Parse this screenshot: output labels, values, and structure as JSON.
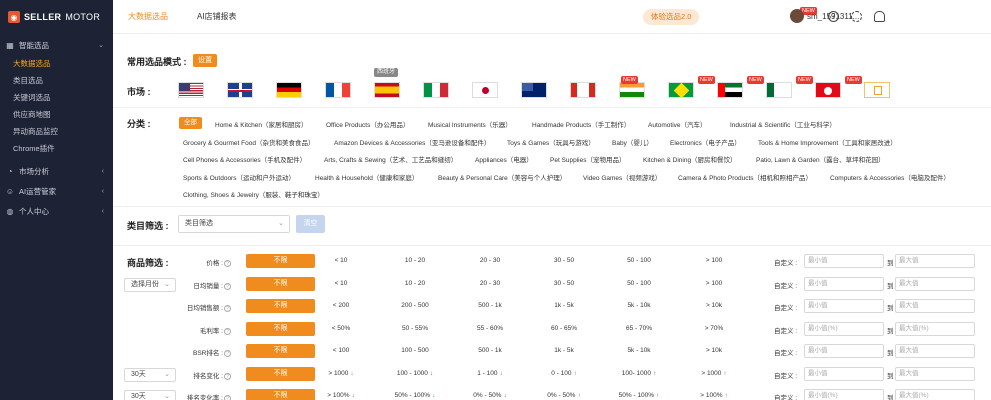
{
  "sidebar": {
    "logo": {
      "bold": "SELLER",
      "thin": "MOTOR"
    },
    "groups": [
      {
        "label": "智能选品",
        "icon": "grid-icon"
      },
      {
        "label": "市场分析",
        "icon": "chart-icon"
      },
      {
        "label": "AI运营管家",
        "icon": "robot-icon"
      },
      {
        "label": "个人中心",
        "icon": "user-icon"
      }
    ],
    "sub_items": [
      "大数据选品",
      "类目选品",
      "关键词选品",
      "供应商地图",
      "异动商品监控",
      "Chrome插件"
    ]
  },
  "header": {
    "tabs": [
      "大数据选品",
      "AI店铺报表"
    ],
    "trial_label": "体验选品2.0",
    "new_label": "NEW",
    "help_glyph": "?",
    "user_name": "sm_1591311..."
  },
  "common_mode": {
    "label": "常用选品模式 :",
    "button": "设置"
  },
  "market": {
    "label": "市场 :",
    "tooltip": "西班牙",
    "new_label": "NEW"
  },
  "category": {
    "label": "分类 :",
    "all": "全部",
    "rows": [
      [
        "Home & Kitchen（家居和厨房）",
        "Office Products（办公用品）",
        "Musical Instruments（乐器）",
        "Handmade Products（手工制作）",
        "Automotive（汽车）",
        "Industrial & Scientific（工业与科学）"
      ],
      [
        "Grocery & Gourmet Food（杂货和美食食品）",
        "Amazon Devices & Accessories（亚马逊设备和配件）",
        "Toys & Games（玩具与游戏）",
        "Baby（婴儿）",
        "Electronics（电子产品）",
        "Tools & Home Improvement（工具和家居改进）"
      ],
      [
        "Cell Phones & Accessories（手机及配件）",
        "Arts, Crafts & Sewing（艺术、工艺品和缝纫）",
        "Appliances（电器）",
        "Pet Supplies（宠物用品）",
        "Kitchen & Dining（厨房和餐饮）",
        "Patio, Lawn & Garden（露台、草坪和花园）"
      ],
      [
        "Sports & Outdoors（运动和户外运动）",
        "Health & Household（健康和家庭）",
        "Beauty & Personal Care（美容与个人护理）",
        "Video Games（视频游戏）",
        "Camera & Photo Products（相机和照相产品）",
        "Computers & Accessories（电脑及配件）"
      ],
      [
        "Clothing, Shoes & Jewelry（服装、鞋子和珠宝）"
      ]
    ]
  },
  "category_filter": {
    "label": "类目筛选 :",
    "placeholder": "类目筛选",
    "clear": "清空"
  },
  "product_filter": {
    "label": "商品筛选 :",
    "unlimited": "不限",
    "custom_label": "自定义 :",
    "to": "到",
    "help_glyph": "?",
    "rows": [
      {
        "name": "价格 :",
        "options": [
          "< 10",
          "10 - 20",
          "20 - 30",
          "30 - 50",
          "50 - 100",
          "> 100"
        ],
        "min": "最小值",
        "max": "最大值",
        "select": ""
      },
      {
        "name": "日均销量 :",
        "options": [
          "< 10",
          "10 - 20",
          "20 - 30",
          "30 - 50",
          "50 - 100",
          "> 100"
        ],
        "min": "最小值",
        "max": "最大值",
        "select": "选择月份"
      },
      {
        "name": "日均销售额 :",
        "options": [
          "< 200",
          "200 - 500",
          "500 - 1k",
          "1k - 5k",
          "5k - 10k",
          "> 10k"
        ],
        "min": "最小值",
        "max": "最大值",
        "select": ""
      },
      {
        "name": "毛利率 :",
        "options": [
          "< 50%",
          "50 - 55%",
          "55 - 60%",
          "60 - 65%",
          "65 - 70%",
          "> 70%"
        ],
        "min": "最小值(%)",
        "max": "最大值(%)",
        "select": ""
      },
      {
        "name": "BSR排名 :",
        "options": [
          "< 100",
          "100 - 500",
          "500 - 1k",
          "1k - 5k",
          "5k - 10k",
          "> 10k"
        ],
        "min": "最小值",
        "max": "最大值",
        "select": ""
      },
      {
        "name": "排名变化 :",
        "options": [
          "> 1000",
          "100 - 1000",
          "1 - 100",
          "0 - 100",
          "100- 1000",
          "> 1000"
        ],
        "arrows": [
          "↓",
          "↓",
          "↓",
          "↑",
          "↑",
          "↑"
        ],
        "min": "最小值",
        "max": "最大值",
        "select": "30天"
      },
      {
        "name": "排名变化率 :",
        "options": [
          "> 100%",
          "50% - 100%",
          "0% - 50%",
          "0% - 50%",
          "50% - 100%",
          "> 100%"
        ],
        "arrows": [
          "↓",
          "↓",
          "↓",
          "↑",
          "↑",
          "↑"
        ],
        "min": "最小值(%)",
        "max": "最大值(%)",
        "select": "30天"
      }
    ]
  },
  "colors": {
    "accent": "#f08c1e",
    "sidebar_bg": "#1d2234",
    "down": "#2f9e5a",
    "up": "#e23b3b"
  }
}
